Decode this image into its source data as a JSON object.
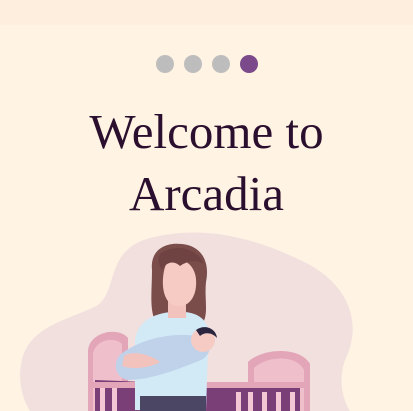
{
  "onboarding": {
    "pager": {
      "total": 4,
      "current": 4
    },
    "title_line1": "Welcome to",
    "title_line2": "Arcadia",
    "illustration": "mother-holding-baby-by-crib",
    "colors": {
      "background": "#fff3e3",
      "dot_active": "#7a4a8a",
      "dot_inactive": "#bdbdbd",
      "title": "#2a0f2e"
    }
  }
}
